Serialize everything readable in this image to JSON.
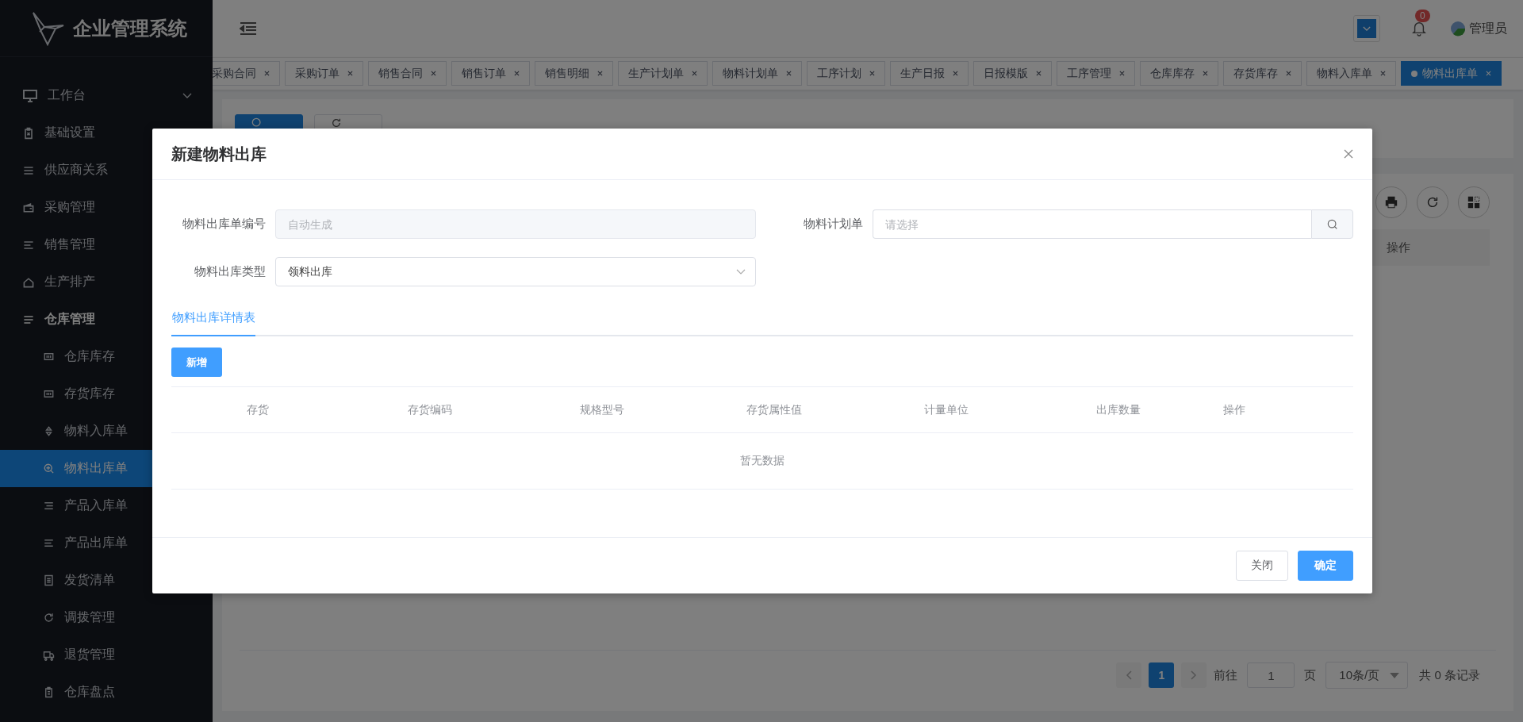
{
  "app": {
    "title": "企业管理系统"
  },
  "header": {
    "notification_count": "0",
    "user": "管理员"
  },
  "sidebar": {
    "items": [
      {
        "label": "工作台",
        "expanded": false
      },
      {
        "label": "基础设置"
      },
      {
        "label": "供应商关系"
      },
      {
        "label": "采购管理"
      },
      {
        "label": "销售管理"
      },
      {
        "label": "生产排产"
      },
      {
        "label": "仓库管理",
        "expanded": true,
        "children": [
          {
            "label": "仓库库存",
            "selected": false
          },
          {
            "label": "存货库存",
            "selected": false
          },
          {
            "label": "物料入库单",
            "selected": false
          },
          {
            "label": "物料出库单",
            "selected": true
          },
          {
            "label": "产品入库单",
            "selected": false
          },
          {
            "label": "产品出库单",
            "selected": false
          },
          {
            "label": "发货清单",
            "selected": false
          },
          {
            "label": "调拨管理",
            "selected": false
          },
          {
            "label": "退货管理",
            "selected": false
          },
          {
            "label": "仓库盘点",
            "selected": false
          }
        ]
      }
    ]
  },
  "tabs": [
    {
      "label": "采购合同",
      "selected": false
    },
    {
      "label": "采购订单",
      "selected": false
    },
    {
      "label": "销售合同",
      "selected": false
    },
    {
      "label": "销售订单",
      "selected": false
    },
    {
      "label": "销售明细",
      "selected": false
    },
    {
      "label": "生产计划单",
      "selected": false
    },
    {
      "label": "物料计划单",
      "selected": false
    },
    {
      "label": "工序计划",
      "selected": false
    },
    {
      "label": "生产日报",
      "selected": false
    },
    {
      "label": "日报模版",
      "selected": false
    },
    {
      "label": "工序管理",
      "selected": false
    },
    {
      "label": "仓库库存",
      "selected": false
    },
    {
      "label": "存货库存",
      "selected": false
    },
    {
      "label": "物料入库单",
      "selected": false
    },
    {
      "label": "物料出库单",
      "selected": true
    }
  ],
  "toolbar": {
    "buttons": [
      {
        "kind": "primary"
      },
      {
        "kind": "default"
      }
    ]
  },
  "background_table": {
    "columns": [
      "操作"
    ]
  },
  "pagination": {
    "pages": [
      {
        "label": "1",
        "selected": true
      }
    ],
    "goto_label": "前往",
    "page_input": "1",
    "page_suffix": "页",
    "page_size": "10条/页",
    "total": "共 0 条记录"
  },
  "dialog": {
    "title": "新建物料出库",
    "fields": [
      {
        "label": "物料出库单编号",
        "kind": "text",
        "placeholder": "自动生成",
        "disabled": true
      },
      {
        "label": "物料计划单",
        "kind": "search",
        "placeholder": "请选择"
      },
      {
        "label": "物料出库类型",
        "kind": "select",
        "value": "领料出库"
      }
    ],
    "tabs": [
      {
        "label": "物料出库详情表",
        "selected": true
      }
    ],
    "add_button": "新增",
    "table": {
      "columns": [
        "存货",
        "存货编码",
        "规格型号",
        "存货属性值",
        "计量单位",
        "出库数量",
        "操作"
      ],
      "empty_text": "暂无数据"
    },
    "buttons": [
      {
        "label": "关闭",
        "kind": "default"
      },
      {
        "label": "确定",
        "kind": "primary"
      }
    ]
  }
}
